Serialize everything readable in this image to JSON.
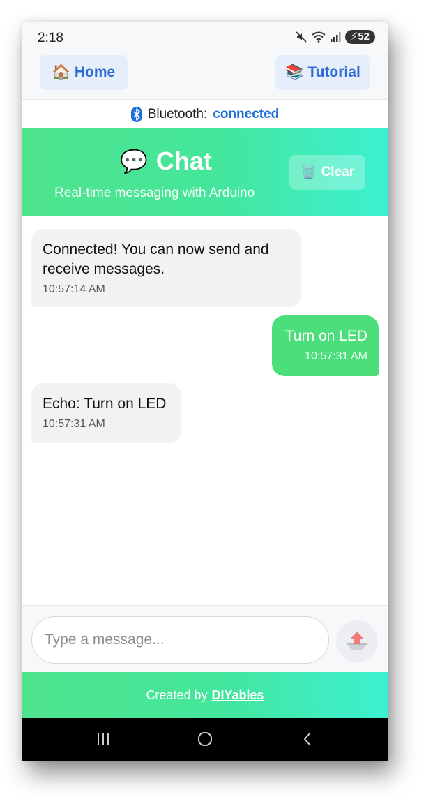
{
  "status_bar": {
    "time": "2:18",
    "battery": "52"
  },
  "nav": {
    "home": {
      "icon": "🏠",
      "label": "Home"
    },
    "tutorial": {
      "icon": "📚",
      "label": "Tutorial"
    }
  },
  "bluetooth": {
    "label": "Bluetooth:",
    "state": "connected"
  },
  "header": {
    "icon": "💬",
    "title": "Chat",
    "subtitle": "Real-time messaging with Arduino",
    "clear_icon": "🗑️",
    "clear_label": "Clear"
  },
  "messages": [
    {
      "direction": "incoming",
      "text": "Connected! You can now send and receive messages.",
      "time": "10:57:14 AM"
    },
    {
      "direction": "outgoing",
      "text": "Turn on LED",
      "time": "10:57:31 AM"
    },
    {
      "direction": "incoming",
      "text": "Echo: Turn on LED",
      "time": "10:57:31 AM"
    }
  ],
  "input": {
    "placeholder": "Type a message...",
    "value": ""
  },
  "footer": {
    "prefix": "Created by",
    "link": "DIYables"
  },
  "colors": {
    "accent_green": "#4fe38c",
    "accent_teal": "#3df0d2",
    "outgoing_bubble": "#4cde7b",
    "link_blue": "#1e6fd9"
  }
}
